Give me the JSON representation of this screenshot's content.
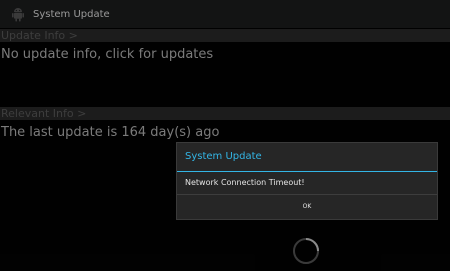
{
  "action_bar": {
    "title": "System Update",
    "icon": "android-icon"
  },
  "update_info": {
    "header": "Update Info >",
    "text": "No update info, click for updates"
  },
  "relevant_info": {
    "header": "Relevant Info >",
    "text": "The last update is 164 day(s) ago"
  },
  "dialog": {
    "title": "System Update",
    "message": "Network Connection Timeout!",
    "ok_label": "OK"
  },
  "colors": {
    "accent": "#33b5e5",
    "background": "#030303",
    "dialog_bg": "#262626"
  }
}
